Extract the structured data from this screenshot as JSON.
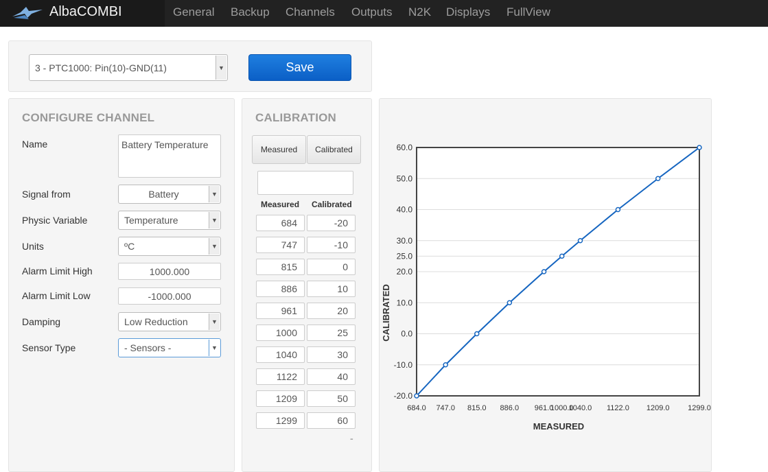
{
  "app": {
    "name": "AlbaCOMBI"
  },
  "nav": [
    "General",
    "Backup",
    "Channels",
    "Outputs",
    "N2K",
    "Displays",
    "FullView"
  ],
  "channel_select": {
    "value": "3 - PTC1000: Pin(10)-GND(11)"
  },
  "save_label": "Save",
  "config": {
    "title": "CONFIGURE CHANNEL",
    "name_label": "Name",
    "name_value": "Battery Temperature",
    "signal_label": "Signal from",
    "signal_value": "Battery",
    "physic_label": "Physic Variable",
    "physic_value": "Temperature",
    "units_label": "Units",
    "units_value": "ºC",
    "alarm_high_label": "Alarm Limit High",
    "alarm_high_value": "1000.000",
    "alarm_low_label": "Alarm Limit Low",
    "alarm_low_value": "-1000.000",
    "damping_label": "Damping",
    "damping_value": "Low Reduction",
    "sensor_label": "Sensor Type",
    "sensor_value": "- Sensors -"
  },
  "calibration": {
    "title": "CALIBRATION",
    "btn_measured": "Measured",
    "btn_calibrated": "Calibrated",
    "input_value": "",
    "col_measured": "Measured",
    "col_calibrated": "Calibrated",
    "rows": [
      {
        "m": "684",
        "c": "-20"
      },
      {
        "m": "747",
        "c": "-10"
      },
      {
        "m": "815",
        "c": "0"
      },
      {
        "m": "886",
        "c": "10"
      },
      {
        "m": "961",
        "c": "20"
      },
      {
        "m": "1000",
        "c": "25"
      },
      {
        "m": "1040",
        "c": "30"
      },
      {
        "m": "1122",
        "c": "40"
      },
      {
        "m": "1209",
        "c": "50"
      },
      {
        "m": "1299",
        "c": "60"
      }
    ],
    "remove_label": "-"
  },
  "chart_data": {
    "type": "line",
    "xlabel": "MEASURED",
    "ylabel": "CALIBRATED",
    "x": [
      684,
      747,
      815,
      886,
      961,
      1000,
      1040,
      1122,
      1209,
      1299
    ],
    "y": [
      -20,
      -10,
      0,
      10,
      20,
      25,
      30,
      40,
      50,
      60
    ],
    "x_ticks": [
      "684.0",
      "747.0",
      "815.0",
      "886.0",
      "961.0",
      "1000.0",
      "1040.0",
      "1122.0",
      "1209.0",
      "1299.0"
    ],
    "y_ticks": [
      "60.0",
      "50.0",
      "40.0",
      "30.0",
      "25.0",
      "20.0",
      "10.0",
      "0.0",
      "-10.0",
      "-20.0"
    ],
    "xlim": [
      684,
      1299
    ],
    "ylim": [
      -20,
      60
    ],
    "grid": true,
    "line_color": "#1565c0"
  }
}
